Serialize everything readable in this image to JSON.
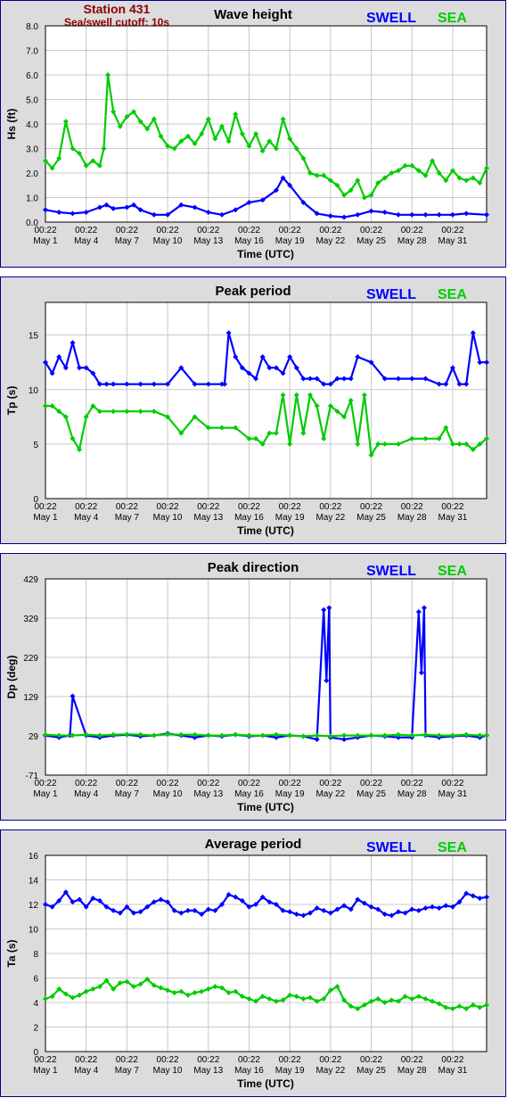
{
  "header": {
    "station": "Station 431",
    "cutoff": "Sea/swell cutoff: 10s"
  },
  "legend": {
    "swell": "SWELL",
    "sea": "SEA"
  },
  "colors": {
    "swell": "#0000ff",
    "sea": "#00cc00",
    "panel_bg": "#dcdcdc",
    "plot_bg": "#ffffff",
    "border": "#00008b"
  },
  "x_ticks": [
    {
      "time": "00:22",
      "date": "May 1"
    },
    {
      "time": "00:22",
      "date": "May 4"
    },
    {
      "time": "00:22",
      "date": "May 7"
    },
    {
      "time": "00:22",
      "date": "May 10"
    },
    {
      "time": "00:22",
      "date": "May 13"
    },
    {
      "time": "00:22",
      "date": "May 16"
    },
    {
      "time": "00:22",
      "date": "May 19"
    },
    {
      "time": "00:22",
      "date": "May 22"
    },
    {
      "time": "00:22",
      "date": "May 25"
    },
    {
      "time": "00:22",
      "date": "May 28"
    },
    {
      "time": "00:22",
      "date": "May 31"
    }
  ],
  "chart_data": [
    {
      "type": "line",
      "title": "Wave height",
      "xlabel": "Time (UTC)",
      "ylabel": "Hs (ft)",
      "xlim": [
        1,
        33.5
      ],
      "ylim": [
        0,
        8
      ],
      "yticks": [
        "0.0",
        "1.0",
        "2.0",
        "3.0",
        "4.0",
        "5.0",
        "6.0",
        "7.0",
        "8.0"
      ],
      "grid": true,
      "series": [
        {
          "name": "SWELL",
          "x": [
            1,
            2,
            3,
            4,
            5,
            5.5,
            6,
            7,
            7.5,
            8,
            9,
            10,
            11,
            12,
            13,
            14,
            15,
            16,
            17,
            18,
            18.5,
            19,
            20,
            21,
            22,
            23,
            24,
            25,
            26,
            27,
            28,
            29,
            30,
            31,
            32,
            33.5
          ],
          "y": [
            0.5,
            0.4,
            0.35,
            0.4,
            0.6,
            0.7,
            0.55,
            0.6,
            0.7,
            0.5,
            0.3,
            0.3,
            0.7,
            0.6,
            0.4,
            0.3,
            0.5,
            0.8,
            0.9,
            1.3,
            1.8,
            1.5,
            0.8,
            0.35,
            0.25,
            0.2,
            0.3,
            0.45,
            0.4,
            0.3,
            0.3,
            0.3,
            0.3,
            0.3,
            0.35,
            0.3
          ]
        },
        {
          "name": "SEA",
          "x": [
            1,
            1.5,
            2,
            2.5,
            3,
            3.5,
            4,
            4.5,
            5,
            5.3,
            5.6,
            6,
            6.5,
            7,
            7.5,
            8,
            8.5,
            9,
            9.5,
            10,
            10.5,
            11,
            11.5,
            12,
            12.5,
            13,
            13.5,
            14,
            14.5,
            15,
            15.5,
            16,
            16.5,
            17,
            17.5,
            18,
            18.5,
            19,
            19.5,
            20,
            20.5,
            21,
            21.5,
            22,
            22.5,
            23,
            23.5,
            24,
            24.5,
            25,
            25.5,
            26,
            26.5,
            27,
            27.5,
            28,
            28.5,
            29,
            29.5,
            30,
            30.5,
            31,
            31.5,
            32,
            32.5,
            33,
            33.5
          ],
          "y": [
            2.5,
            2.2,
            2.6,
            4.1,
            3.0,
            2.8,
            2.3,
            2.5,
            2.3,
            3.0,
            6.0,
            4.5,
            3.9,
            4.3,
            4.5,
            4.1,
            3.8,
            4.2,
            3.5,
            3.1,
            3.0,
            3.3,
            3.5,
            3.2,
            3.6,
            4.2,
            3.4,
            3.9,
            3.3,
            4.4,
            3.6,
            3.1,
            3.6,
            2.9,
            3.3,
            3.0,
            4.2,
            3.4,
            3.0,
            2.6,
            2.0,
            1.9,
            1.9,
            1.7,
            1.5,
            1.1,
            1.3,
            1.7,
            1.0,
            1.1,
            1.6,
            1.8,
            2.0,
            2.1,
            2.3,
            2.3,
            2.1,
            1.9,
            2.5,
            2.0,
            1.7,
            2.1,
            1.8,
            1.7,
            1.8,
            1.6,
            2.2
          ]
        }
      ]
    },
    {
      "type": "line",
      "title": "Peak period",
      "xlabel": "Time (UTC)",
      "ylabel": "Tp (s)",
      "xlim": [
        1,
        33.5
      ],
      "ylim": [
        0,
        18
      ],
      "yticks": [
        "0",
        "5",
        "10",
        "15"
      ],
      "grid": true,
      "series": [
        {
          "name": "SWELL",
          "x": [
            1,
            1.5,
            2,
            2.5,
            3,
            3.5,
            4,
            4.5,
            5,
            5.5,
            6,
            7,
            8,
            9,
            10,
            11,
            12,
            13,
            14,
            14.2,
            14.5,
            15,
            15.5,
            16,
            16.5,
            17,
            17.5,
            18,
            18.5,
            19,
            19.5,
            20,
            20.5,
            21,
            21.5,
            22,
            22.5,
            23,
            23.5,
            24,
            25,
            26,
            27,
            28,
            29,
            30,
            30.5,
            31,
            31.5,
            32,
            32.5,
            33,
            33.5
          ],
          "y": [
            12.5,
            11.5,
            13,
            12,
            14.3,
            12,
            12,
            11.5,
            10.5,
            10.5,
            10.5,
            10.5,
            10.5,
            10.5,
            10.5,
            12,
            10.5,
            10.5,
            10.5,
            10.5,
            15.2,
            13,
            12,
            11.5,
            11,
            13,
            12,
            12,
            11.5,
            13,
            12,
            11,
            11,
            11,
            10.5,
            10.5,
            11,
            11,
            11,
            13,
            12.5,
            11,
            11,
            11,
            11,
            10.5,
            10.5,
            12,
            10.5,
            10.5,
            15.2,
            12.5,
            12.5
          ]
        },
        {
          "name": "SEA",
          "x": [
            1,
            1.5,
            2,
            2.5,
            3,
            3.5,
            4,
            4.5,
            5,
            6,
            7,
            8,
            9,
            10,
            11,
            12,
            13,
            14,
            15,
            16,
            16.5,
            17,
            17.5,
            18,
            18.5,
            19,
            19.5,
            20,
            20.5,
            21,
            21.5,
            22,
            22.5,
            23,
            23.5,
            24,
            24.5,
            25,
            25.5,
            26,
            27,
            28,
            29,
            30,
            30.5,
            31,
            31.5,
            32,
            32.5,
            33,
            33.5
          ],
          "y": [
            8.5,
            8.5,
            8,
            7.5,
            5.5,
            4.5,
            7.5,
            8.5,
            8,
            8,
            8,
            8,
            8,
            7.5,
            6,
            7.5,
            6.5,
            6.5,
            6.5,
            5.5,
            5.5,
            5,
            6,
            6,
            9.5,
            5,
            9.5,
            6,
            9.5,
            8.5,
            5.5,
            8.5,
            8,
            7.5,
            9,
            5,
            9.5,
            4,
            5,
            5,
            5,
            5.5,
            5.5,
            5.5,
            6.5,
            5,
            5,
            5,
            4.5,
            5,
            5.5
          ]
        }
      ]
    },
    {
      "type": "scatter",
      "title": "Peak direction",
      "xlabel": "Time (UTC)",
      "ylabel": "Dp (deg)",
      "xlim": [
        1,
        33.5
      ],
      "ylim": [
        -71,
        429
      ],
      "yticks": [
        "-71",
        "29",
        "129",
        "229",
        "329",
        "429"
      ],
      "grid": true,
      "series": [
        {
          "name": "SWELL",
          "x": [
            1,
            2,
            2.8,
            3,
            4,
            5,
            6,
            7,
            8,
            9,
            10,
            11,
            12,
            13,
            14,
            15,
            16,
            17,
            18,
            19,
            20,
            21,
            21.5,
            21.7,
            21.9,
            22,
            23,
            24,
            25,
            26,
            27,
            28,
            28.5,
            28.7,
            28.9,
            29,
            30,
            31,
            32,
            33,
            33.5
          ],
          "y": [
            30,
            25,
            30,
            130,
            30,
            25,
            30,
            32,
            28,
            30,
            35,
            30,
            25,
            30,
            28,
            32,
            28,
            30,
            25,
            30,
            28,
            20,
            350,
            170,
            355,
            25,
            20,
            25,
            30,
            28,
            25,
            25,
            345,
            190,
            355,
            30,
            25,
            28,
            30,
            25,
            30
          ]
        },
        {
          "name": "SEA",
          "x": [
            1,
            2,
            3,
            4,
            5,
            6,
            7,
            8,
            9,
            10,
            11,
            12,
            13,
            14,
            15,
            16,
            17,
            18,
            19,
            20,
            21,
            22,
            23,
            24,
            25,
            26,
            27,
            28,
            29,
            30,
            31,
            32,
            33,
            33.5
          ],
          "y": [
            32,
            30,
            30,
            32,
            30,
            32,
            33,
            32,
            30,
            33,
            32,
            32,
            30,
            30,
            32,
            30,
            30,
            32,
            30,
            28,
            30,
            28,
            30,
            30,
            30,
            30,
            32,
            30,
            32,
            30,
            30,
            32,
            30,
            30
          ]
        }
      ]
    },
    {
      "type": "line",
      "title": "Average period",
      "xlabel": "Time (UTC)",
      "ylabel": "Ta (s)",
      "xlim": [
        1,
        33.5
      ],
      "ylim": [
        0,
        16
      ],
      "yticks": [
        "0",
        "2",
        "4",
        "6",
        "8",
        "10",
        "12",
        "14",
        "16"
      ],
      "grid": true,
      "series": [
        {
          "name": "SWELL",
          "x": [
            1,
            1.5,
            2,
            2.5,
            3,
            3.5,
            4,
            4.5,
            5,
            5.5,
            6,
            6.5,
            7,
            7.5,
            8,
            8.5,
            9,
            9.5,
            10,
            10.5,
            11,
            11.5,
            12,
            12.5,
            13,
            13.5,
            14,
            14.5,
            15,
            15.5,
            16,
            16.5,
            17,
            17.5,
            18,
            18.5,
            19,
            19.5,
            20,
            20.5,
            21,
            21.5,
            22,
            22.5,
            23,
            23.5,
            24,
            24.5,
            25,
            25.5,
            26,
            26.5,
            27,
            27.5,
            28,
            28.5,
            29,
            29.5,
            30,
            30.5,
            31,
            31.5,
            32,
            32.5,
            33,
            33.5
          ],
          "y": [
            12,
            11.8,
            12.3,
            13,
            12.2,
            12.4,
            11.8,
            12.5,
            12.3,
            11.8,
            11.5,
            11.3,
            11.8,
            11.3,
            11.4,
            11.8,
            12.2,
            12.4,
            12.2,
            11.5,
            11.3,
            11.5,
            11.5,
            11.2,
            11.6,
            11.5,
            12,
            12.8,
            12.6,
            12.3,
            11.8,
            12,
            12.6,
            12.2,
            12,
            11.5,
            11.4,
            11.2,
            11.1,
            11.3,
            11.7,
            11.5,
            11.3,
            11.6,
            11.9,
            11.6,
            12.4,
            12.1,
            11.8,
            11.6,
            11.2,
            11.1,
            11.4,
            11.3,
            11.6,
            11.5,
            11.7,
            11.8,
            11.7,
            11.9,
            11.8,
            12.2,
            12.9,
            12.7,
            12.5,
            12.6
          ]
        },
        {
          "name": "SEA",
          "x": [
            1,
            1.5,
            2,
            2.5,
            3,
            3.5,
            4,
            4.5,
            5,
            5.5,
            6,
            6.5,
            7,
            7.5,
            8,
            8.5,
            9,
            9.5,
            10,
            10.5,
            11,
            11.5,
            12,
            12.5,
            13,
            13.5,
            14,
            14.5,
            15,
            15.5,
            16,
            16.5,
            17,
            17.5,
            18,
            18.5,
            19,
            19.5,
            20,
            20.5,
            21,
            21.5,
            22,
            22.5,
            23,
            23.5,
            24,
            24.5,
            25,
            25.5,
            26,
            26.5,
            27,
            27.5,
            28,
            28.5,
            29,
            29.5,
            30,
            30.5,
            31,
            31.5,
            32,
            32.5,
            33,
            33.5
          ],
          "y": [
            4.3,
            4.5,
            5.1,
            4.7,
            4.4,
            4.6,
            4.9,
            5.1,
            5.3,
            5.8,
            5.1,
            5.6,
            5.7,
            5.3,
            5.5,
            5.9,
            5.4,
            5.2,
            5,
            4.8,
            4.9,
            4.6,
            4.8,
            4.9,
            5.1,
            5.3,
            5.2,
            4.8,
            4.9,
            4.5,
            4.3,
            4.1,
            4.5,
            4.3,
            4.1,
            4.2,
            4.6,
            4.5,
            4.3,
            4.4,
            4.1,
            4.3,
            5,
            5.3,
            4.2,
            3.7,
            3.5,
            3.8,
            4.1,
            4.3,
            4,
            4.2,
            4.1,
            4.5,
            4.3,
            4.5,
            4.3,
            4.1,
            3.9,
            3.6,
            3.5,
            3.7,
            3.5,
            3.8,
            3.6,
            3.8
          ]
        }
      ]
    }
  ]
}
